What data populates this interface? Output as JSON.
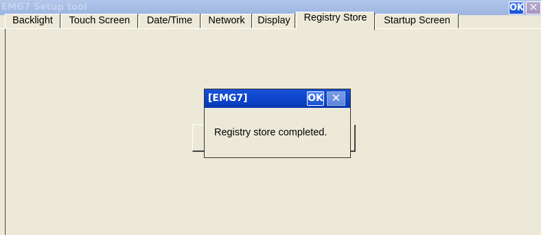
{
  "window": {
    "title": "EMG7 Setup tool",
    "ok_label": "OK",
    "close_label": "✕"
  },
  "tabs": [
    {
      "label": "Backlight",
      "active": false
    },
    {
      "label": "Touch Screen",
      "active": false
    },
    {
      "label": "Date/Time",
      "active": false
    },
    {
      "label": "Network",
      "active": false
    },
    {
      "label": "Display",
      "active": false
    },
    {
      "label": "Registry Store",
      "active": true
    },
    {
      "label": "Startup Screen",
      "active": false
    }
  ],
  "dialog": {
    "title": "[EMG7]",
    "ok_label": "OK",
    "close_label": "✕",
    "message": "Registry store completed."
  },
  "colors": {
    "window_bg": "#ece9d8",
    "dialog_titlebar": "#0a43c9",
    "inactive_titlebar": "#a6bde6"
  }
}
